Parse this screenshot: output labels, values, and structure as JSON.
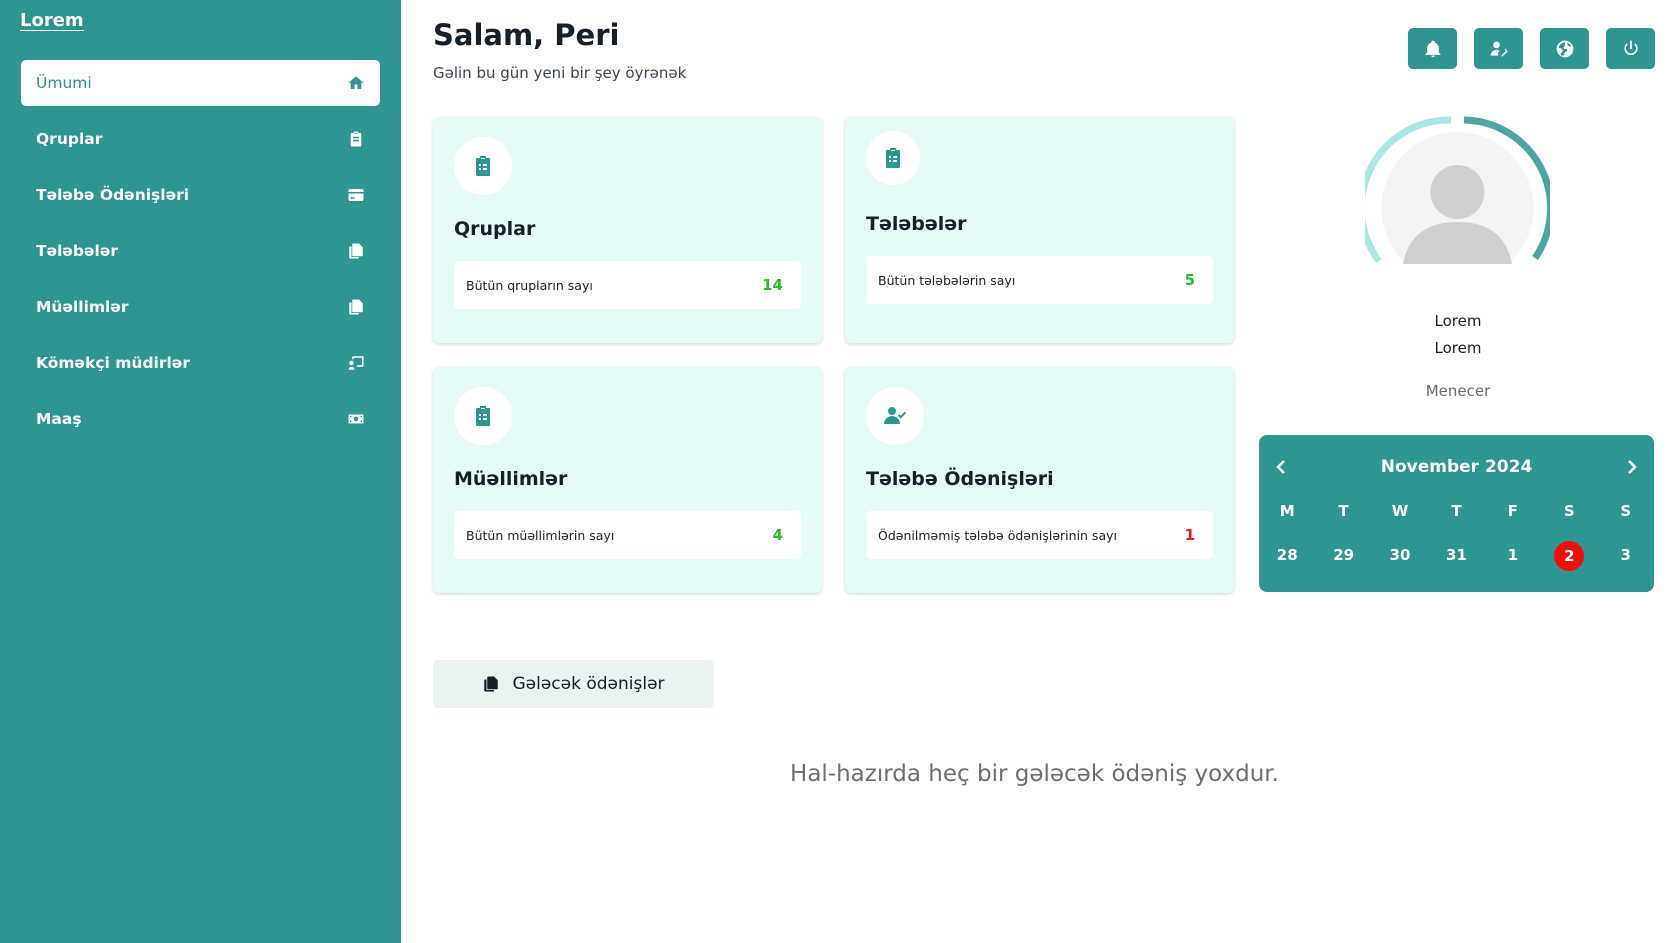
{
  "sidebar": {
    "logo": "Lorem",
    "items": [
      {
        "label": "Ümumi",
        "icon": "home-icon"
      },
      {
        "label": "Qruplar",
        "icon": "clipboard-icon"
      },
      {
        "label": "Tələbə Ödənişləri",
        "icon": "credit-card-icon"
      },
      {
        "label": "Tələbələr",
        "icon": "copy-icon"
      },
      {
        "label": "Müəllimlər",
        "icon": "copy-icon"
      },
      {
        "label": "Köməkçi müdirlər",
        "icon": "chalkboard-user-icon"
      },
      {
        "label": "Maaş",
        "icon": "money-icon"
      }
    ]
  },
  "header": {
    "greeting": "Salam, Peri",
    "subtitle": "Gəlin bu gün yeni bir şey öyrənək",
    "actions": [
      "bell-icon",
      "user-edit-icon",
      "globe-icon",
      "power-icon"
    ]
  },
  "cards": [
    {
      "title": "Qruplar",
      "label": "Bütün qrupların sayı",
      "value": "14",
      "icon": "clipboard-list-icon"
    },
    {
      "title": "Tələbələr",
      "label": "Bütün tələbələrin sayı",
      "value": "5",
      "icon": "clipboard-list-icon"
    },
    {
      "title": "Müəllimlər",
      "label": "Bütün müəllimlərin sayı",
      "value": "4",
      "icon": "clipboard-list-icon"
    },
    {
      "title": "Tələbə Ödənişləri",
      "label": "Ödənilməmiş tələbə ödənişlərinin sayı",
      "value": "1",
      "icon": "user-check-icon"
    }
  ],
  "profile": {
    "name_line1": "Lorem",
    "name_line2": "Lorem",
    "role": "Menecer"
  },
  "calendar": {
    "month": "November 2024",
    "weekdays": [
      "M",
      "T",
      "W",
      "T",
      "F",
      "S",
      "S"
    ],
    "days": [
      "28",
      "29",
      "30",
      "31",
      "1",
      "2",
      "3"
    ],
    "today": "2",
    "today_color": "#f20d0d"
  },
  "upcoming": {
    "button_label": "Gələcək ödənişlər",
    "empty_message": "Hal-hazırda heç bir gələcək ödəniş yoxdur."
  },
  "colors": {
    "accent": "#2e9590",
    "card_bg": "#e6fbf8",
    "count_green": "#2bbf2b",
    "count_red": "#e21c1c"
  }
}
